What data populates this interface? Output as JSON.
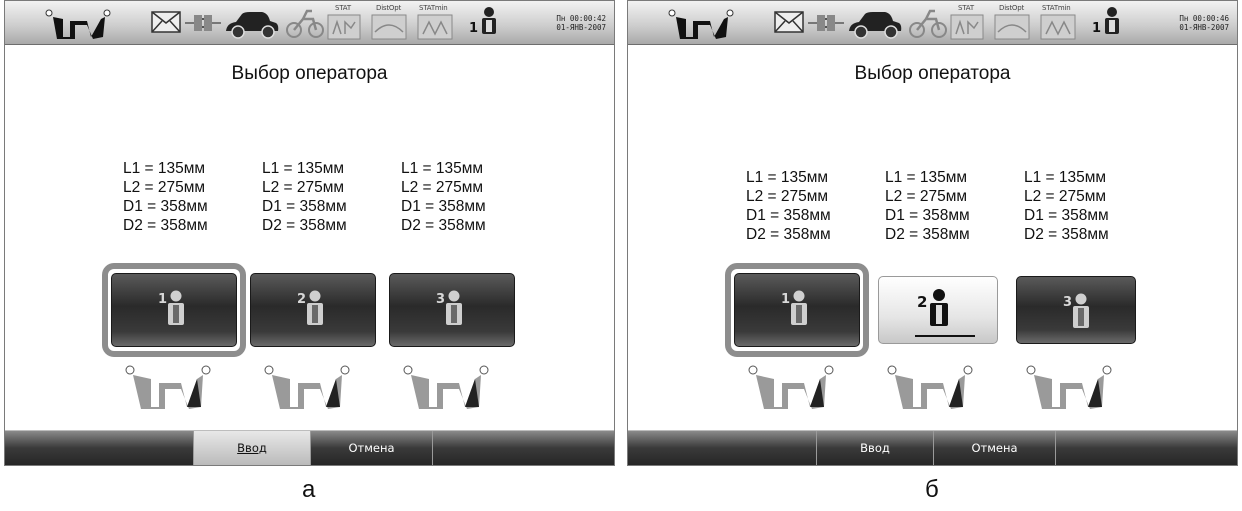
{
  "status_bar": {
    "labels": [
      "STAT",
      "DistOpt",
      "STATmin"
    ],
    "operator_number": "1",
    "icons": [
      "wheel-balancer-logo-icon",
      "envelope-icon",
      "plug-icon",
      "car-icon",
      "motorcycle-icon",
      "stat-icon",
      "distopt-icon",
      "statmin-icon",
      "operator-icon"
    ]
  },
  "screens": [
    {
      "id": "a",
      "datetime_line1": "Пн 00:00:42",
      "datetime_line2": "01-ЯНВ-2007",
      "title": "Выбор оператора",
      "operators": [
        {
          "number": "1",
          "l1": "L1 = 135мм",
          "l2": "L2 = 275мм",
          "d1": "D1 = 358мм",
          "d2": "D2 = 358мм",
          "selected": true,
          "highlighted": false
        },
        {
          "number": "2",
          "l1": "L1 = 135мм",
          "l2": "L2 = 275мм",
          "d1": "D1 = 358мм",
          "d2": "D2 = 358мм",
          "selected": false,
          "highlighted": false
        },
        {
          "number": "3",
          "l1": "L1 = 135мм",
          "l2": "L2 = 275мм",
          "d1": "D1 = 358мм",
          "d2": "D2 = 358мм",
          "selected": false,
          "highlighted": false
        }
      ],
      "bottom": {
        "enter": "Ввод",
        "cancel": "Отмена",
        "enter_pressed": true
      },
      "figure_label": "а"
    },
    {
      "id": "b",
      "datetime_line1": "Пн 00:00:46",
      "datetime_line2": "01-ЯНВ-2007",
      "title": "Выбор оператора",
      "operators": [
        {
          "number": "1",
          "l1": "L1 = 135мм",
          "l2": "L2 = 275мм",
          "d1": "D1 = 358мм",
          "d2": "D2 = 358мм",
          "selected": true,
          "highlighted": false
        },
        {
          "number": "2",
          "l1": "L1 = 135мм",
          "l2": "L2 = 275мм",
          "d1": "D1 = 358мм",
          "d2": "D2 = 358мм",
          "selected": false,
          "highlighted": true
        },
        {
          "number": "3",
          "l1": "L1 = 135мм",
          "l2": "L2 = 275мм",
          "d1": "D1 = 358мм",
          "d2": "D2 = 358мм",
          "selected": false,
          "highlighted": false
        }
      ],
      "bottom": {
        "enter": "Ввод",
        "cancel": "Отмена",
        "enter_pressed": false
      },
      "figure_label": "б"
    }
  ]
}
